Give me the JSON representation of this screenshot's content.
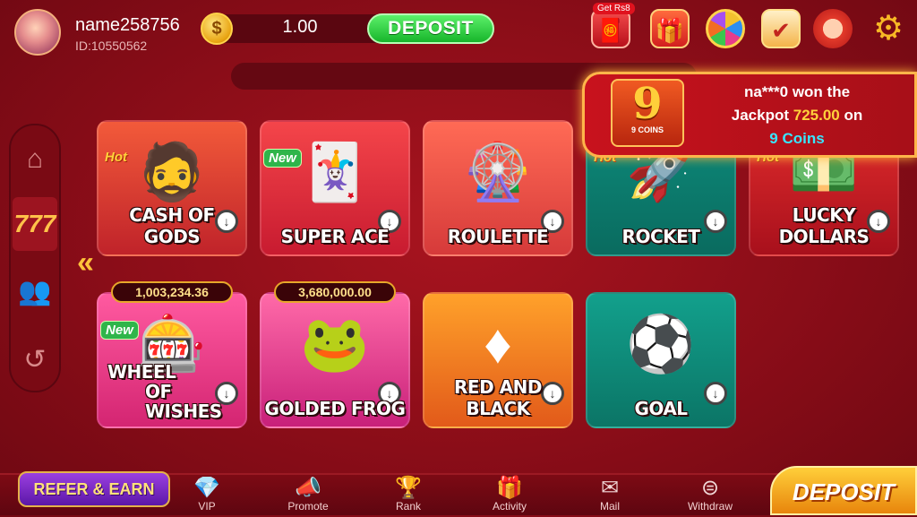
{
  "header": {
    "username": "name258756",
    "user_id": "ID:10550562",
    "balance": "1.00",
    "deposit_label": "DEPOSIT",
    "get_rs_label": "Get Rs8"
  },
  "jackpot_notice": {
    "tile_number": "9",
    "tile_label": "9 COINS",
    "line1": "na***0 won the",
    "line2_prefix": "Jackpot",
    "amount": "725.00",
    "line2_suffix": "on",
    "game": "9 Coins"
  },
  "games": [
    {
      "name": "CASH OF GODS",
      "badge": "Hot"
    },
    {
      "name": "SUPER ACE",
      "badge": "New"
    },
    {
      "name": "ROULETTE",
      "badge": ""
    },
    {
      "name": "ROCKET",
      "badge": "Hot"
    },
    {
      "name": "LUCKY DOLLARS",
      "badge": "Hot"
    },
    {
      "name_line1": "WHEEL",
      "name_line2": "OF WISHES",
      "badge": "New",
      "pool": "1,003,234.36"
    },
    {
      "name": "GOLDED FROG",
      "badge": "",
      "pool": "3,680,000.00"
    },
    {
      "name": "RED AND BLACK",
      "badge": ""
    },
    {
      "name": "GOAL",
      "badge": ""
    }
  ],
  "bottom_nav": {
    "refer_label": "REFER & EARN",
    "items": [
      "VIP",
      "Promote",
      "Rank",
      "Activity",
      "Mail",
      "Withdraw"
    ],
    "deposit_label": "DEPOSIT"
  },
  "colors": {
    "background": "#8a0d18",
    "accent_gold": "#ffc23a",
    "deposit_green": "#17b52b"
  }
}
